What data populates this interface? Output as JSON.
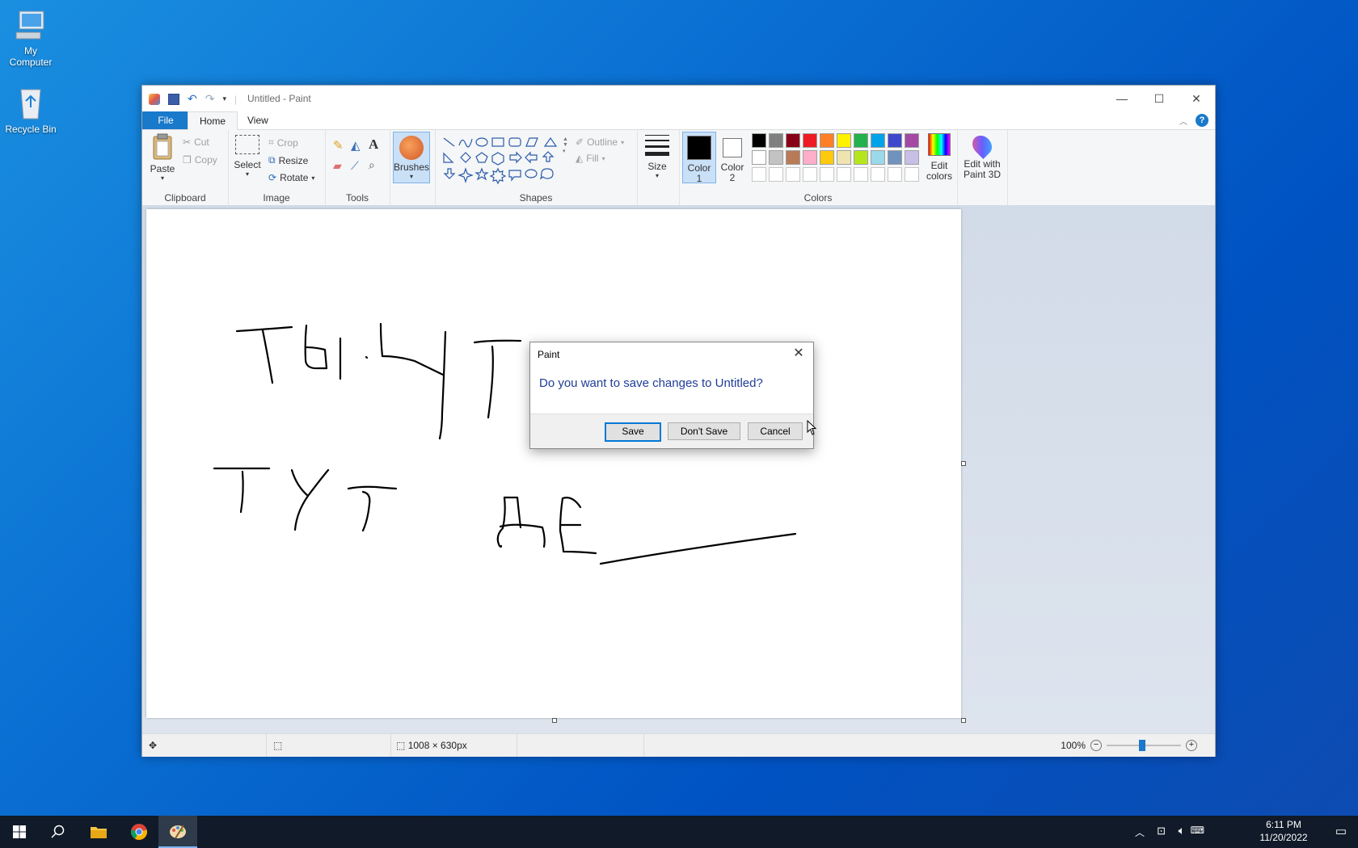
{
  "desktop": {
    "icons": [
      {
        "label": "My\nComputer",
        "icon": "computer-icon"
      },
      {
        "label": "Recycle Bin",
        "icon": "recycle-bin-icon"
      }
    ]
  },
  "window": {
    "title": "Untitled - Paint",
    "tabs": {
      "file": "File",
      "home": "Home",
      "view": "View"
    },
    "clipboard": {
      "paste": "Paste",
      "cut": "Cut",
      "copy": "Copy",
      "group": "Clipboard"
    },
    "image": {
      "select": "Select",
      "crop": "Crop",
      "resize": "Resize",
      "rotate": "Rotate",
      "group": "Image"
    },
    "tools": {
      "group": "Tools"
    },
    "brushes": {
      "label": "Brushes"
    },
    "shapes": {
      "outline": "Outline",
      "fill": "Fill",
      "group": "Shapes"
    },
    "size": {
      "label": "Size"
    },
    "colors": {
      "color1": "Color\n1",
      "color2": "Color\n2",
      "edit_colors": "Edit\ncolors",
      "group": "Colors",
      "palette_row1": [
        "#000000",
        "#7f7f7f",
        "#880015",
        "#ed1c24",
        "#ff7f27",
        "#fff200",
        "#22b14c",
        "#00a2e8",
        "#3f48cc",
        "#a349a4"
      ],
      "palette_row2": [
        "#ffffff",
        "#c3c3c3",
        "#b97a57",
        "#ffaec9",
        "#ffc90e",
        "#efe4b0",
        "#b5e61d",
        "#99d9ea",
        "#7092be",
        "#c8bfe7"
      ]
    },
    "paint3d": {
      "label": "Edit with\nPaint 3D"
    },
    "status": {
      "canvas_size": "1008 × 630px",
      "zoom": "100%"
    }
  },
  "dialog": {
    "title": "Paint",
    "message": "Do you want to save changes to Untitled?",
    "save": "Save",
    "dont_save": "Don't Save",
    "cancel": "Cancel"
  },
  "taskbar": {
    "time": "6:11 PM",
    "date": "11/20/2022"
  }
}
